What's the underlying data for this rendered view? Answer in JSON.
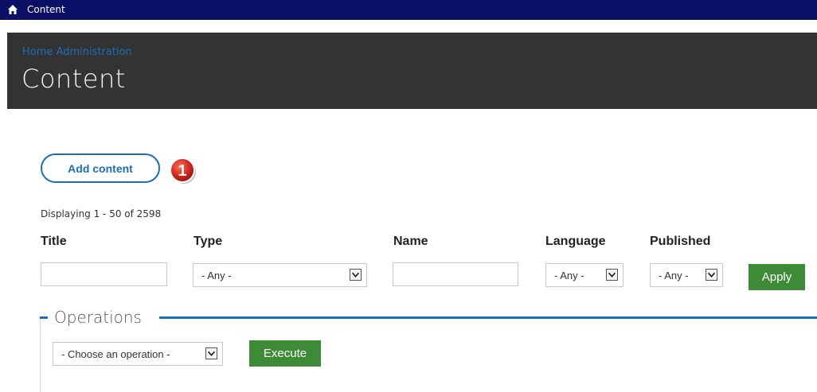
{
  "topbar": {
    "label": "Content",
    "icon": "home-icon"
  },
  "header": {
    "breadcrumb": "Home Administration",
    "title": "Content"
  },
  "actions": {
    "add_content_label": "Add content",
    "callout_number": "1"
  },
  "listing": {
    "count_text": "Displaying 1 - 50 of 2598"
  },
  "filters": {
    "title_label": "Title",
    "title_value": "",
    "type_label": "Type",
    "type_value": "- Any -",
    "name_label": "Name",
    "name_value": "",
    "language_label": "Language",
    "language_value": "- Any -",
    "published_label": "Published",
    "published_value": "- Any -",
    "apply_label": "Apply"
  },
  "operations": {
    "legend": "Operations",
    "select_value": "- Choose an operation -",
    "execute_label": "Execute"
  },
  "colors": {
    "topbar": "#0b0f66",
    "header": "#333333",
    "accent": "#1a6fb8",
    "button": "#3d8b37",
    "callout": "#d42a1e"
  }
}
